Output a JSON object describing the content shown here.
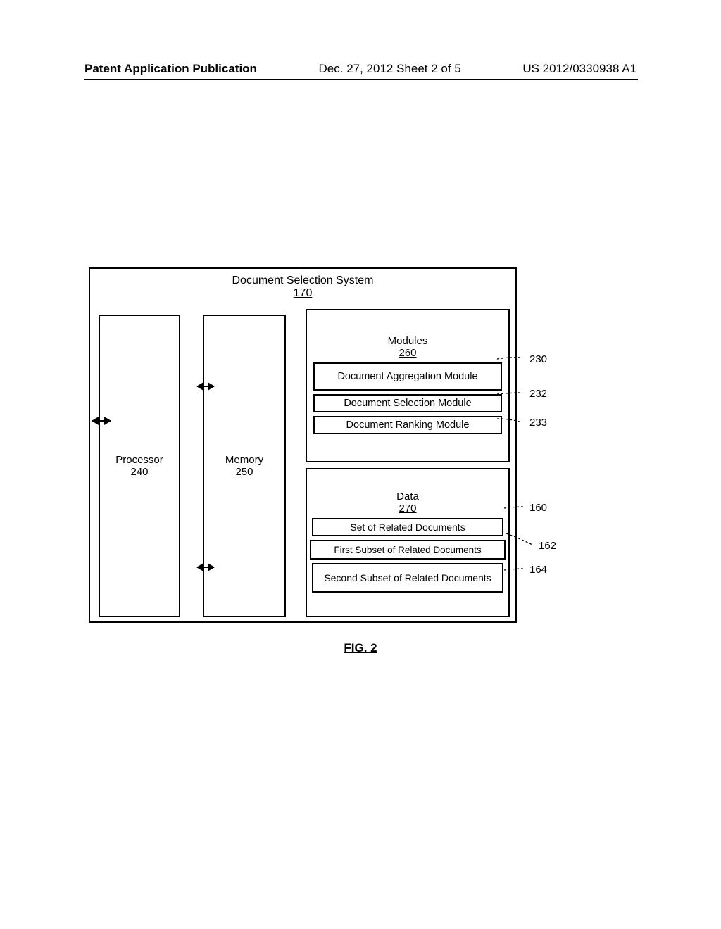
{
  "header": {
    "left": "Patent Application Publication",
    "center": "Dec. 27, 2012  Sheet 2 of 5",
    "right": "US 2012/0330938 A1"
  },
  "system": {
    "title": "Document Selection System",
    "num": "170"
  },
  "processor": {
    "label": "Processor",
    "num": "240"
  },
  "memory": {
    "label": "Memory",
    "num": "250"
  },
  "modules": {
    "title": "Modules",
    "num": "260",
    "items": [
      {
        "label": "Document Aggregation Module",
        "ref": "230"
      },
      {
        "label": "Document Selection Module",
        "ref": "232"
      },
      {
        "label": "Document Ranking Module",
        "ref": "233"
      }
    ]
  },
  "data": {
    "title": "Data",
    "num": "270",
    "items": [
      {
        "label": "Set of Related Documents",
        "ref": "160"
      },
      {
        "label": "First Subset of Related Documents",
        "ref": "162"
      },
      {
        "label": "Second Subset of Related Documents",
        "ref": "164"
      }
    ]
  },
  "figure": "FIG. 2"
}
